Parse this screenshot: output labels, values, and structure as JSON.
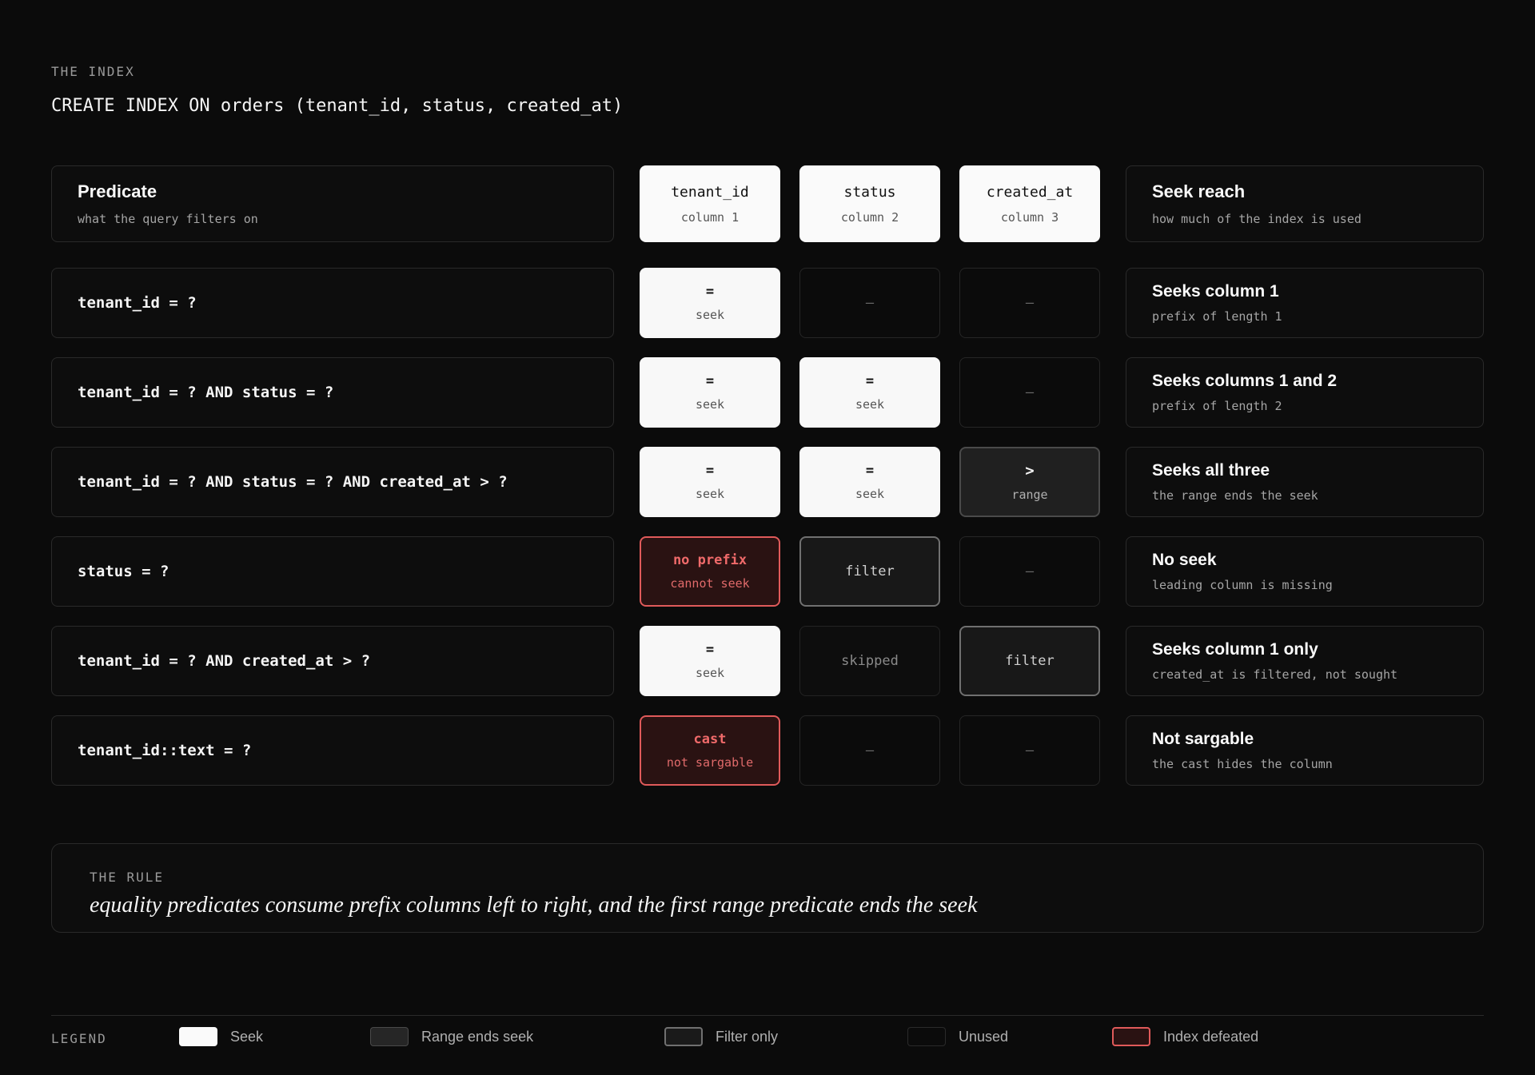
{
  "index": {
    "eyebrow": "THE INDEX",
    "statement": "CREATE INDEX ON orders (tenant_id, status, created_at)"
  },
  "header": {
    "predicate_title": "Predicate",
    "predicate_sub": "what the query filters on",
    "columns": [
      {
        "name": "tenant_id",
        "position": "column 1"
      },
      {
        "name": "status",
        "position": "column 2"
      },
      {
        "name": "created_at",
        "position": "column 3"
      }
    ],
    "reach_title": "Seek reach",
    "reach_sub": "how much of the index is used"
  },
  "rows": [
    {
      "predicate": "tenant_id = ?",
      "cells": [
        {
          "state": "seek",
          "main": "=",
          "sub": "seek"
        },
        {
          "state": "unused",
          "main": "–",
          "sub": ""
        },
        {
          "state": "unused",
          "main": "–",
          "sub": ""
        }
      ],
      "reach_title": "Seeks column 1",
      "reach_sub": "prefix of length 1"
    },
    {
      "predicate": "tenant_id = ? AND status = ?",
      "cells": [
        {
          "state": "seek",
          "main": "=",
          "sub": "seek"
        },
        {
          "state": "seek",
          "main": "=",
          "sub": "seek"
        },
        {
          "state": "unused",
          "main": "–",
          "sub": ""
        }
      ],
      "reach_title": "Seeks columns 1 and 2",
      "reach_sub": "prefix of length 2"
    },
    {
      "predicate": "tenant_id = ? AND status = ? AND created_at > ?",
      "cells": [
        {
          "state": "seek",
          "main": "=",
          "sub": "seek"
        },
        {
          "state": "seek",
          "main": "=",
          "sub": "seek"
        },
        {
          "state": "range",
          "main": ">",
          "sub": "range"
        }
      ],
      "reach_title": "Seeks all three",
      "reach_sub": "the range ends the seek"
    },
    {
      "predicate": "status = ?",
      "cells": [
        {
          "state": "defeated",
          "main": "no prefix",
          "sub": "cannot seek"
        },
        {
          "state": "filter",
          "main": "filter",
          "sub": ""
        },
        {
          "state": "unused",
          "main": "–",
          "sub": ""
        }
      ],
      "reach_title": "No seek",
      "reach_sub": "leading column is missing"
    },
    {
      "predicate": "tenant_id = ? AND created_at > ?",
      "cells": [
        {
          "state": "seek",
          "main": "=",
          "sub": "seek"
        },
        {
          "state": "skipped",
          "main": "skipped",
          "sub": ""
        },
        {
          "state": "filter",
          "main": "filter",
          "sub": ""
        }
      ],
      "reach_title": "Seeks column 1 only",
      "reach_sub": "created_at is filtered, not sought"
    },
    {
      "predicate": "tenant_id::text = ?",
      "cells": [
        {
          "state": "defeated",
          "main": "cast",
          "sub": "not sargable"
        },
        {
          "state": "unused",
          "main": "–",
          "sub": ""
        },
        {
          "state": "unused",
          "main": "–",
          "sub": ""
        }
      ],
      "reach_title": "Not sargable",
      "reach_sub": "the cast hides the column"
    }
  ],
  "rule": {
    "label": "THE RULE",
    "text": "equality predicates consume prefix columns left to right, and the first range predicate ends the seek"
  },
  "legend": {
    "label": "LEGEND",
    "items": [
      {
        "state": "seek",
        "label": "Seek"
      },
      {
        "state": "range",
        "label": "Range ends seek"
      },
      {
        "state": "filter",
        "label": "Filter only"
      },
      {
        "state": "unused",
        "label": "Unused"
      },
      {
        "state": "defeated",
        "label": "Index defeated"
      }
    ]
  },
  "colors": {
    "background": "#0b0b0b",
    "seek": "#fafafa",
    "range": "#262626",
    "filter": "#707070",
    "defeated": "#e05a5a"
  }
}
